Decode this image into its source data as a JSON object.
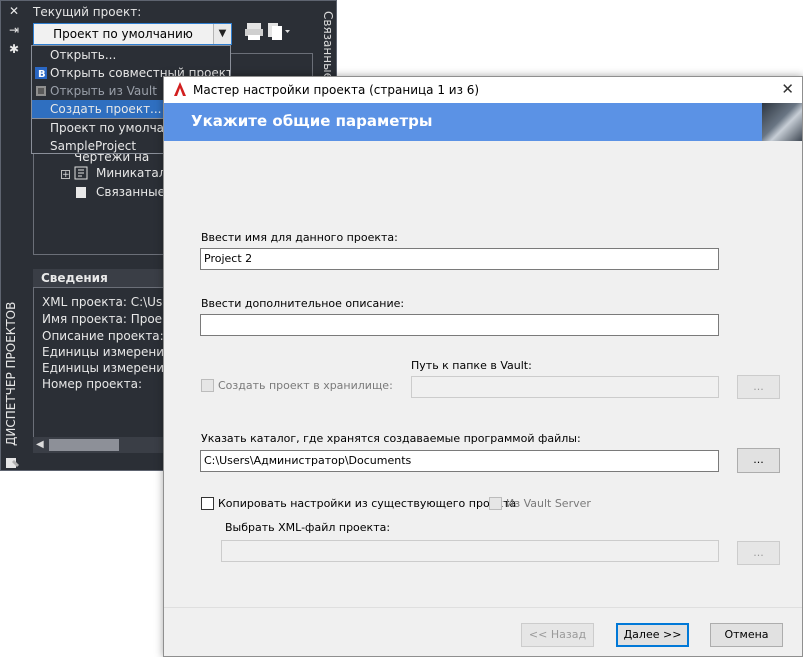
{
  "project_manager": {
    "current_project_label": "Текущий проект:",
    "current_project_value": "Проект по умолчанию",
    "side_title": "ДИСПЕТЧЕР ПРОЕКТОВ",
    "right_strip_text": "Связанные файлы",
    "dropdown_items": [
      {
        "label": "Открыть...",
        "state": "normal"
      },
      {
        "label": "Открыть совместный проект",
        "state": "normal"
      },
      {
        "label": "Открыть из Vault",
        "state": "disabled"
      },
      {
        "label": "Создать проект...",
        "state": "selected"
      },
      {
        "label": "Проект по умолчанию",
        "state": "normal"
      },
      {
        "label": "SampleProject",
        "state": "normal"
      }
    ],
    "tree_items": [
      {
        "label": "Чертежи на"
      },
      {
        "label": "Миникатало"
      },
      {
        "label": "Связанные ф"
      }
    ],
    "details_header": "Сведения",
    "details_lines": [
      "XML проекта: C:\\Users",
      "Имя проекта: Проект",
      "Описание проекта:",
      "Единицы измерения г",
      "Единицы измерения г",
      "Номер проекта:"
    ]
  },
  "wizard": {
    "title": "Мастер настройки проекта (страница 1 из 6)",
    "header": "Укажите общие параметры",
    "name_label": "Ввести имя для данного проекта:",
    "name_value": "Project 2",
    "desc_label": "Ввести дополнительное описание:",
    "desc_value": "",
    "vault_path_label": "Путь к папке в Vault:",
    "vault_checkbox_label": "Создать проект в хранилище:",
    "browse_label": "...",
    "folder_label": "Указать каталог, где хранятся создаваемые программой файлы:",
    "folder_value": "C:\\Users\\Администратор\\Documents",
    "copy_checkbox_label": "Копировать настройки из существующего проекта",
    "vault_server_label": "Из Vault Server",
    "xml_label": "Выбрать XML-файл проекта:",
    "xml_value": "",
    "back_button": "<< Назад",
    "next_button": "Далее >>",
    "cancel_button": "Отмена"
  },
  "colors": {
    "header_blue": "#5b92e5",
    "palette_bg": "#2b2f36",
    "selection_blue": "#2f6fc0",
    "autocad_red": "#d21f1f"
  }
}
